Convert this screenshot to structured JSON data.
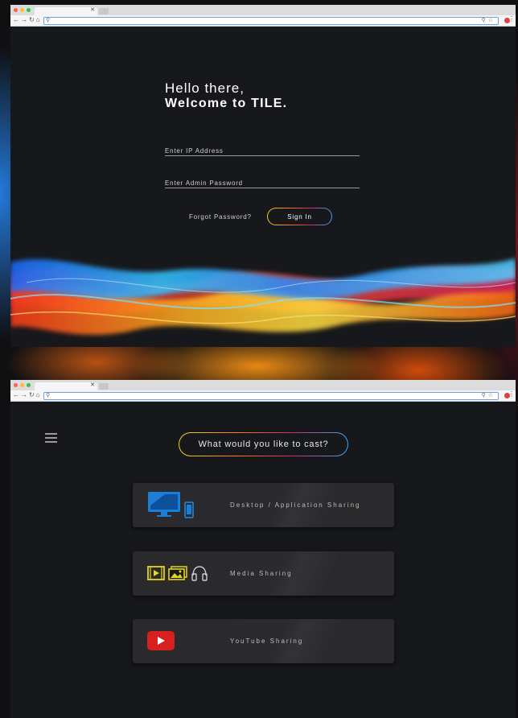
{
  "colors": {
    "accent_yellow": "#f0d020",
    "accent_blue": "#35a7ff",
    "icon_blue": "#1a7fd6",
    "icon_yellow": "#e5d21a",
    "youtube_red": "#d8201e"
  },
  "login": {
    "greeting": "Hello there,",
    "welcome": "Welcome to TILE.",
    "ip_placeholder": "Enter IP Address",
    "password_placeholder": "Enter Admin Password",
    "forgot_label": "Forgot Password?",
    "signin_label": "Sign In"
  },
  "cast": {
    "prompt": "What would you like to cast?",
    "options": [
      {
        "label": "Desktop / Application Sharing",
        "icon": "monitor-phone-icon"
      },
      {
        "label": "Media Sharing",
        "icon": "media-icons"
      },
      {
        "label": "YouTube Sharing",
        "icon": "youtube-icon"
      }
    ]
  }
}
